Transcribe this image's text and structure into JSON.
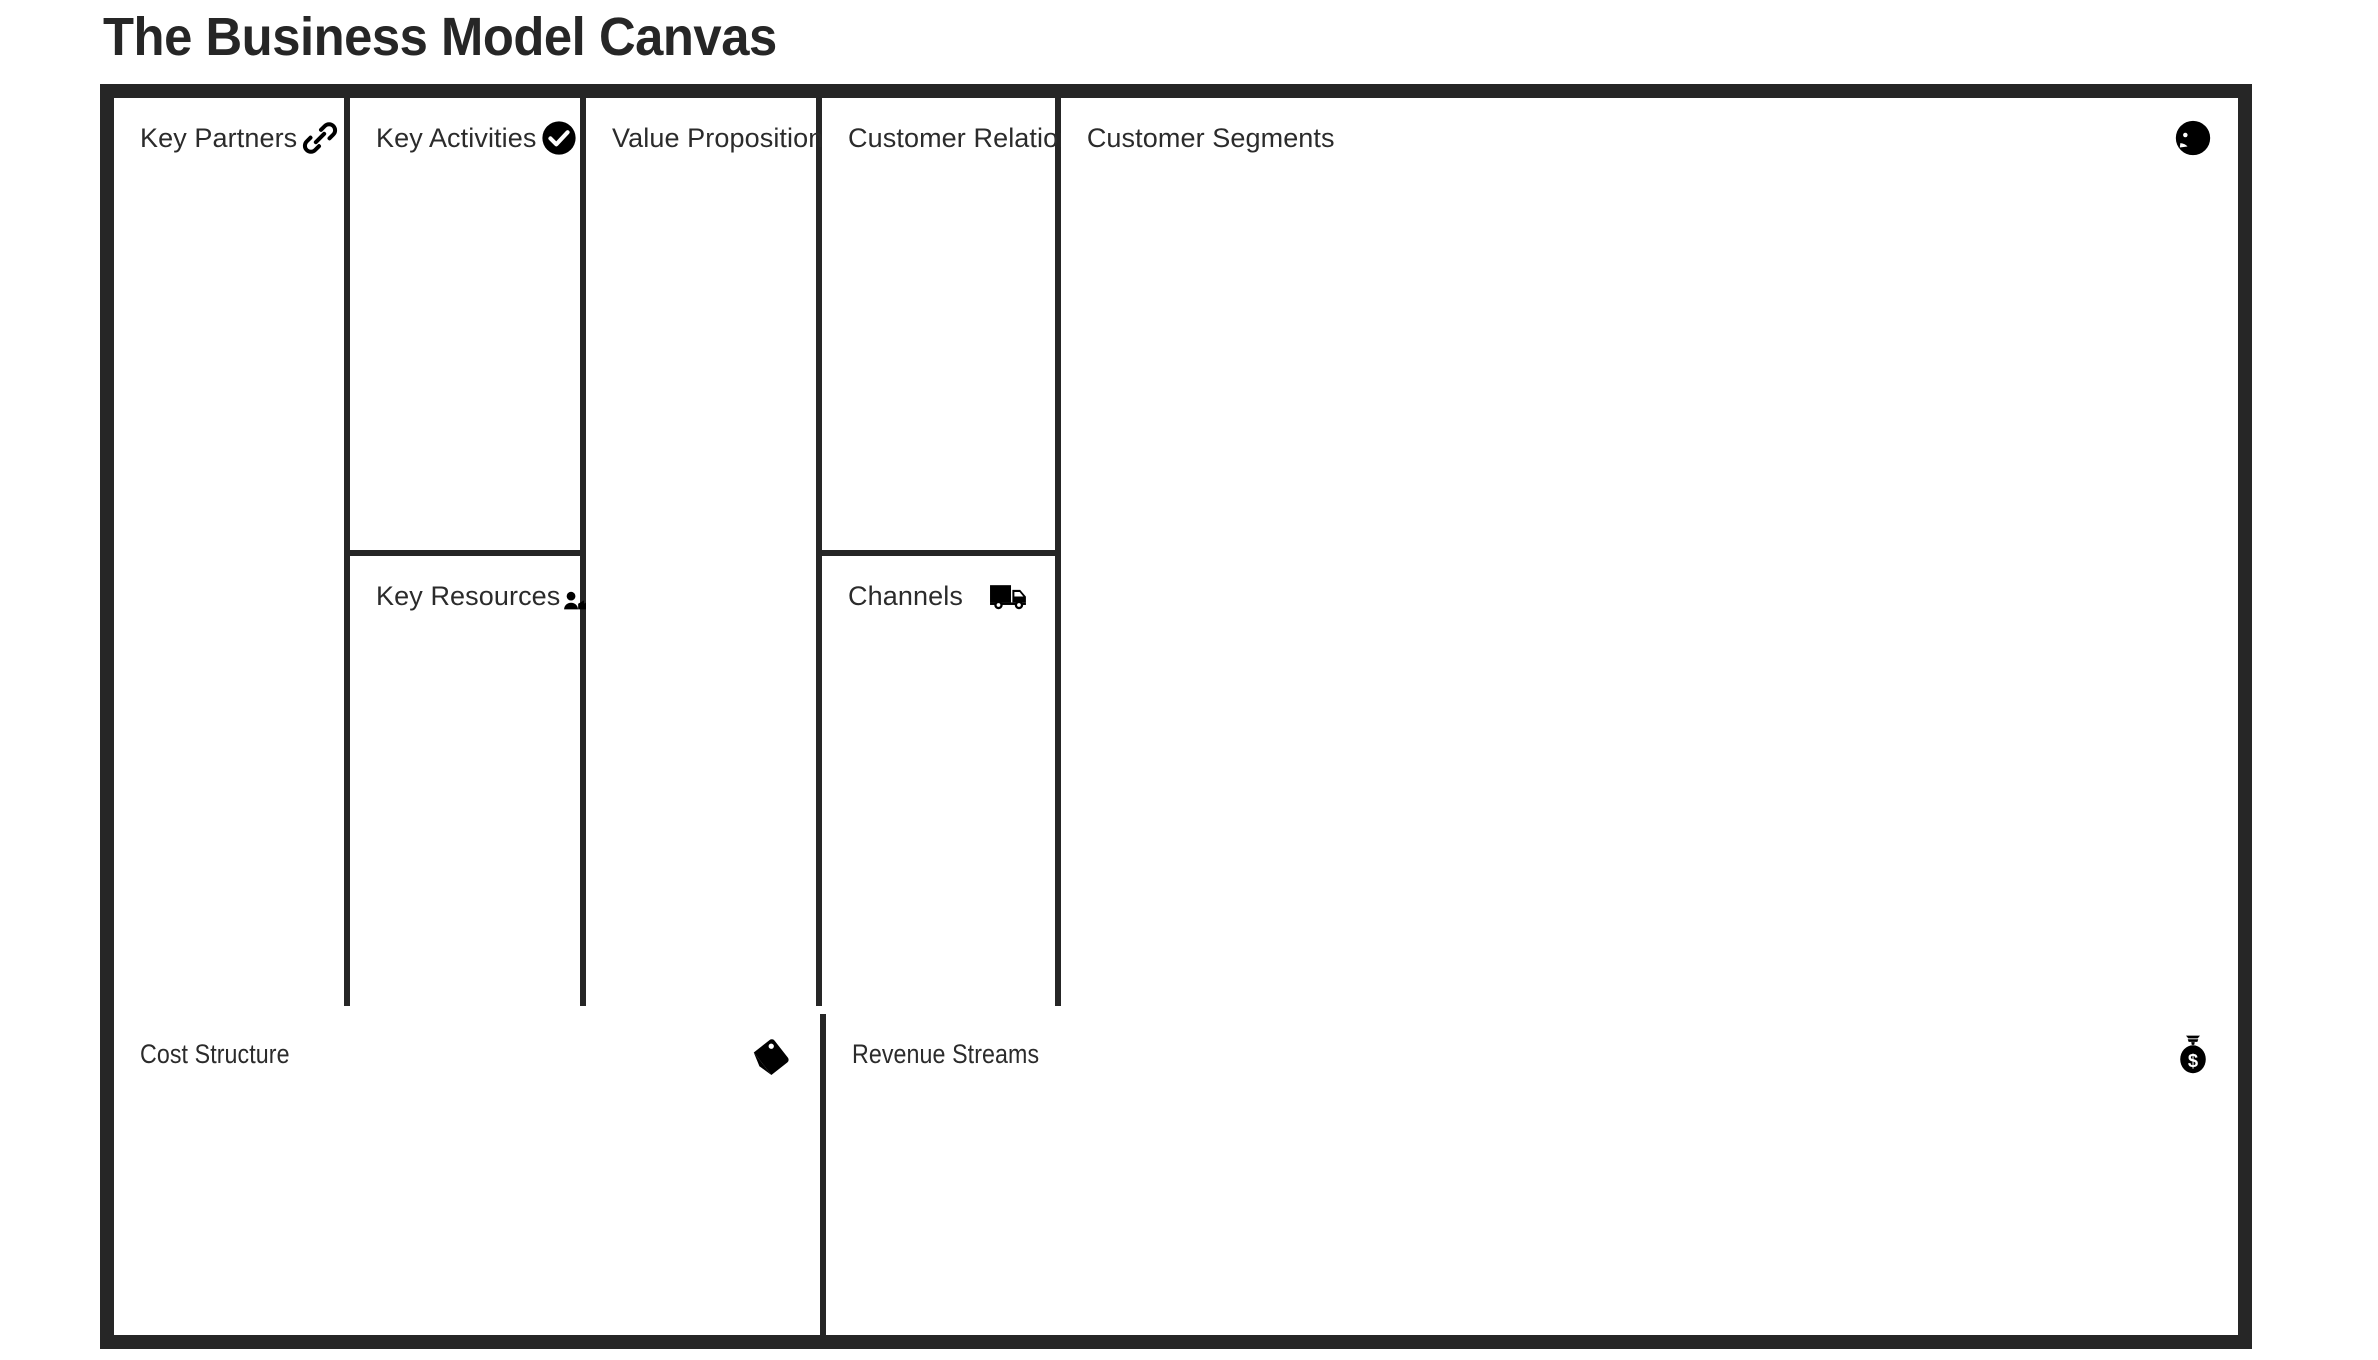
{
  "page": {
    "title": "The Business Model Canvas",
    "frame_color": "#262626",
    "background_color": "#ffffff",
    "label_color": "#2b2b2b",
    "icon_color": "#000000"
  },
  "canvas": {
    "top_row": [
      {
        "key": "key_partners",
        "label": "Key Partners",
        "icon": "link-icon",
        "layout": "full-height"
      },
      {
        "key": "key_activities",
        "label": "Key Activities",
        "icon": "check-circle-icon",
        "layout": "split-top"
      },
      {
        "key": "key_resources",
        "label": "Key Resources",
        "icon": "person-factory-icon",
        "layout": "split-bottom"
      },
      {
        "key": "value_propositions",
        "label": "Value Propositions",
        "icon": "gift-icon",
        "layout": "full-height"
      },
      {
        "key": "customer_relationships",
        "label": "Customer Relationships",
        "icon": "heart-icon",
        "layout": "split-top"
      },
      {
        "key": "channels",
        "label": "Channels",
        "icon": "truck-icon",
        "layout": "split-bottom"
      },
      {
        "key": "customer_segments",
        "label": "Customer Segments",
        "icon": "face-profile-icon",
        "layout": "full-height"
      }
    ],
    "bottom_row": [
      {
        "key": "cost_structure",
        "label": "Cost Structure",
        "icon": "price-tag-icon"
      },
      {
        "key": "revenue_streams",
        "label": "Revenue Streams",
        "icon": "money-bag-icon"
      }
    ]
  }
}
